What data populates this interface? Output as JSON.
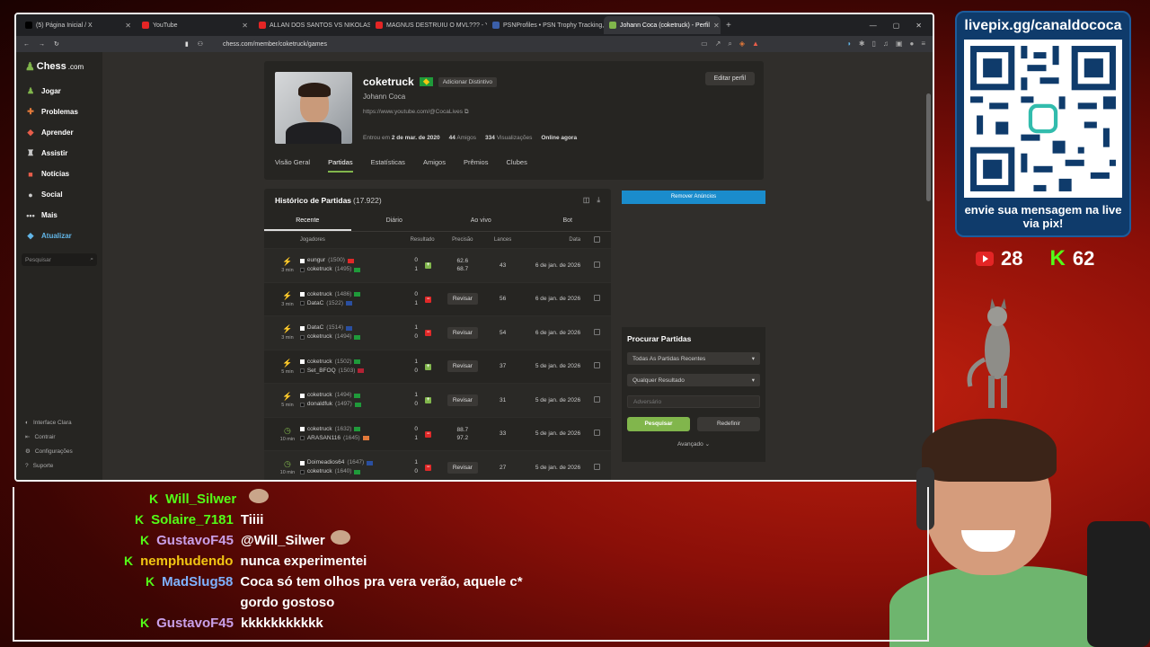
{
  "browser": {
    "tabs": [
      {
        "label": "(5) Página Inicial / X",
        "color": "#000000",
        "active": false
      },
      {
        "label": "YouTube",
        "color": "#e42525",
        "active": false
      },
      {
        "label": "ALLAN DOS SANTOS VS NIKOLAS FE",
        "color": "#e42525",
        "active": false
      },
      {
        "label": "MAGNUS DESTRUIU O MVL??? - You",
        "color": "#e42525",
        "active": false
      },
      {
        "label": "PSNProfiles • PSN Trophy Tracking, S",
        "color": "#3b5fa8",
        "active": false
      },
      {
        "label": "Johann Coca (coketruck) - Perfil",
        "color": "#81b64c",
        "active": true
      }
    ],
    "url": "chess.com/member/coketruck/games"
  },
  "sidebar": {
    "logo": "Chess",
    "logo_suffix": ".com",
    "items": [
      {
        "label": "Jogar",
        "icon": "pawn-icon",
        "glyph": "♟",
        "color": "#81b64c"
      },
      {
        "label": "Problemas",
        "icon": "puzzle-icon",
        "glyph": "✚",
        "color": "#e2793a"
      },
      {
        "label": "Aprender",
        "icon": "learn-icon",
        "glyph": "◆",
        "color": "#e85d4a"
      },
      {
        "label": "Assistir",
        "icon": "watch-icon",
        "glyph": "♜",
        "color": "#cccccc"
      },
      {
        "label": "Notícias",
        "icon": "news-icon",
        "glyph": "■",
        "color": "#e85d4a"
      },
      {
        "label": "Social",
        "icon": "social-icon",
        "glyph": "●",
        "color": "#cccccc"
      },
      {
        "label": "Mais",
        "icon": "more-icon",
        "glyph": "•••",
        "color": "#cccccc"
      },
      {
        "label": "Atualizar",
        "icon": "diamond-icon",
        "glyph": "◆",
        "color": "#62b6e8"
      }
    ],
    "search_placeholder": "Pesquisar",
    "bottom": [
      {
        "label": "Interface Clara",
        "icon": "theme-icon",
        "glyph": "◐"
      },
      {
        "label": "Contrair",
        "icon": "collapse-icon",
        "glyph": "⇤"
      },
      {
        "label": "Configurações",
        "icon": "settings-icon",
        "glyph": "⚙"
      },
      {
        "label": "Suporte",
        "icon": "help-icon",
        "glyph": "?"
      }
    ]
  },
  "profile": {
    "username": "coketruck",
    "badge_btn": "Adicionar Distintivo",
    "real_name": "Johann Coca",
    "link": "https://www.youtube.com/@CocaLives",
    "joined_label": "Entrou em",
    "joined": "2 de mar. de 2020",
    "friends_count": "44",
    "friends_label": "Amigos",
    "views_count": "334",
    "views_label": "Visualizações",
    "status": "Online agora",
    "edit": "Editar perfil",
    "tabs": [
      "Visão Geral",
      "Partidas",
      "Estatísticas",
      "Amigos",
      "Prêmios",
      "Clubes"
    ],
    "active_tab": 1
  },
  "games": {
    "title": "Histórico de Partidas",
    "count": "(17.922)",
    "tabs": [
      "Recente",
      "Diário",
      "Ao vivo",
      "Bot"
    ],
    "headers": {
      "players": "Jogadores",
      "result": "Resultado",
      "accuracy": "Precisão",
      "moves": "Lances",
      "date": "Data"
    },
    "review": "Revisar",
    "rows": [
      {
        "type": "bolt",
        "tc": "3 min",
        "p1": "eungur",
        "r1": "(1500)",
        "f1": "#e02828",
        "p2": "coketruck",
        "r2": "(1495)",
        "f2": "#1f9a3a",
        "s1": "0",
        "s2": "1",
        "outcome": "win",
        "acc1": "62.6",
        "acc2": "68.7",
        "moves": "43",
        "date": "6 de jan. de 2026"
      },
      {
        "type": "bolt",
        "tc": "3 min",
        "p1": "coketruck",
        "r1": "(1486)",
        "f1": "#1f9a3a",
        "p2": "DataC",
        "r2": "(1522)",
        "f2": "#2a4fa0",
        "s1": "0",
        "s2": "1",
        "outcome": "loss",
        "acc1": "",
        "acc2": "",
        "moves": "56",
        "date": "6 de jan. de 2026"
      },
      {
        "type": "bolt",
        "tc": "3 min",
        "p1": "DataC",
        "r1": "(1514)",
        "f1": "#2a4fa0",
        "p2": "coketruck",
        "r2": "(1494)",
        "f2": "#1f9a3a",
        "s1": "1",
        "s2": "0",
        "outcome": "loss",
        "acc1": "",
        "acc2": "",
        "moves": "54",
        "date": "6 de jan. de 2026"
      },
      {
        "type": "bolt",
        "tc": "5 min",
        "p1": "coketruck",
        "r1": "(1502)",
        "f1": "#1f9a3a",
        "p2": "Set_BFOQ",
        "r2": "(1503)",
        "f2": "#b22234",
        "s1": "1",
        "s2": "0",
        "outcome": "win",
        "acc1": "",
        "acc2": "",
        "moves": "37",
        "date": "5 de jan. de 2026"
      },
      {
        "type": "bolt",
        "tc": "5 min",
        "p1": "coketruck",
        "r1": "(1494)",
        "f1": "#1f9a3a",
        "p2": "donaldfuk",
        "r2": "(1497)",
        "f2": "#1f9a3a",
        "s1": "1",
        "s2": "0",
        "outcome": "win",
        "acc1": "",
        "acc2": "",
        "moves": "31",
        "date": "5 de jan. de 2026"
      },
      {
        "type": "clock",
        "tc": "10 min",
        "p1": "coketruck",
        "r1": "(1632)",
        "f1": "#1f9a3a",
        "p2": "ARASAN116",
        "r2": "(1645)",
        "f2": "#e2793a",
        "s1": "0",
        "s2": "1",
        "outcome": "loss",
        "acc1": "88.7",
        "acc2": "97.2",
        "moves": "33",
        "date": "5 de jan. de 2026"
      },
      {
        "type": "clock",
        "tc": "10 min",
        "p1": "Doimeadios64",
        "r1": "(1647)",
        "f1": "#2a4fa0",
        "p2": "coketruck",
        "r2": "(1640)",
        "f2": "#1f9a3a",
        "s1": "1",
        "s2": "0",
        "outcome": "loss",
        "acc1": "",
        "acc2": "",
        "moves": "27",
        "date": "5 de jan. de 2026"
      }
    ]
  },
  "ads": {
    "remove": "Remover Anúncios"
  },
  "search": {
    "title": "Procurar Partidas",
    "select1": "Todas As Partidas Recentes",
    "select2": "Qualquer Resultado",
    "opponent_placeholder": "Adversário",
    "search_btn": "Pesquisar",
    "reset_btn": "Redefinir",
    "advanced": "Avançado"
  },
  "overlay": {
    "qr_title": "livepix.gg/canaldococa",
    "qr_msg": "envie sua mensagem na live via pix!",
    "youtube_count": "28",
    "kick_count": "62"
  },
  "chat": [
    {
      "user": "Will_Silwer",
      "color": "#53fc18",
      "msg": "",
      "emote": true
    },
    {
      "user": "Solaire_7181",
      "color": "#53fc18",
      "msg": "Tiiii",
      "emote": false
    },
    {
      "user": "GustavoF45",
      "color": "#c9a0e8",
      "msg": "@Will_Silwer",
      "emote": true
    },
    {
      "user": "nemphudendo",
      "color": "#f2c613",
      "msg": "nunca experimentei",
      "emote": false
    },
    {
      "user": "MadSlug58",
      "color": "#7fb2ff",
      "msg": "Coca só tem olhos pra vera verão, aquele c* gordo gostoso",
      "emote": false
    },
    {
      "user": "GustavoF45",
      "color": "#c9a0e8",
      "msg": "kkkkkkkkkkk",
      "emote": false
    }
  ]
}
